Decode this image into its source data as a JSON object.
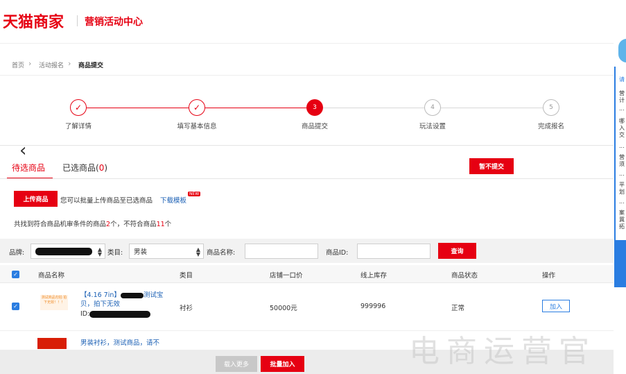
{
  "header": {
    "brand": "天猫商家",
    "subtitle": "营销活动中心"
  },
  "breadcrumb": [
    "首页",
    "活动报名",
    "商品提交"
  ],
  "steps": [
    {
      "index": "✓",
      "label": "了解详情",
      "state": "done"
    },
    {
      "index": "✓",
      "label": "填写基本信息",
      "state": "done"
    },
    {
      "index": "3",
      "label": "商品提交",
      "state": "active"
    },
    {
      "index": "4",
      "label": "玩法设置",
      "state": "todo"
    },
    {
      "index": "5",
      "label": "完成报名",
      "state": "todo"
    }
  ],
  "tabs": {
    "pending": "待选商品",
    "selected": "已选商品",
    "selected_count": "0",
    "paren_open": "(",
    "paren_close": ")"
  },
  "actions": {
    "no_submit": "暂不提交",
    "upload": "上传商品",
    "upload_hint": "您可以批量上传商品至已选商品",
    "download_template": "下载模板",
    "new_badge": "NEW"
  },
  "summary": {
    "prefix": "共找到符合商品机审条件的商品",
    "match_count": "2",
    "middle": "个，不符合商品",
    "nonmatch_count": "11",
    "suffix": "个"
  },
  "filters": {
    "brand_label": "品牌:",
    "category_label": "类目:",
    "category_value": "男装",
    "name_label": "商品名称:",
    "id_label": "商品ID:",
    "query_button": "查询"
  },
  "table": {
    "columns": [
      "商品名称",
      "类目",
      "店铺一口价",
      "线上库存",
      "商品状态",
      "操作"
    ],
    "rows": [
      {
        "name_line1": "【4.16 7in】",
        "name_line1b": "测试宝",
        "name_line2": "贝，拍下无效",
        "id_label": "ID:",
        "thumb_text": "测试商品勿拍 拍下无效！！！",
        "category": "衬衫",
        "price": "50000元",
        "stock": "999996",
        "status": "正常",
        "action": "加入"
      },
      {
        "name_line1": "男装衬衫，测试商品，请不",
        "name_line1b": "",
        "name_line2": "",
        "id_label": "",
        "thumb_text": "",
        "category": "",
        "price": "",
        "stock": "",
        "status": "",
        "action": ""
      }
    ]
  },
  "footer": {
    "load_more": "载入更多",
    "batch_join": "批量加入"
  },
  "side_panel": {
    "title": "请",
    "lines": [
      "营计",
      "...",
      "哪入交",
      "...",
      "营须",
      "...",
      "平划",
      "...",
      "案冀拓"
    ]
  },
  "watermark": "电商运营官",
  "colors": {
    "accent": "#e60012",
    "link": "#1a5fb4",
    "check": "#2a7de1"
  }
}
